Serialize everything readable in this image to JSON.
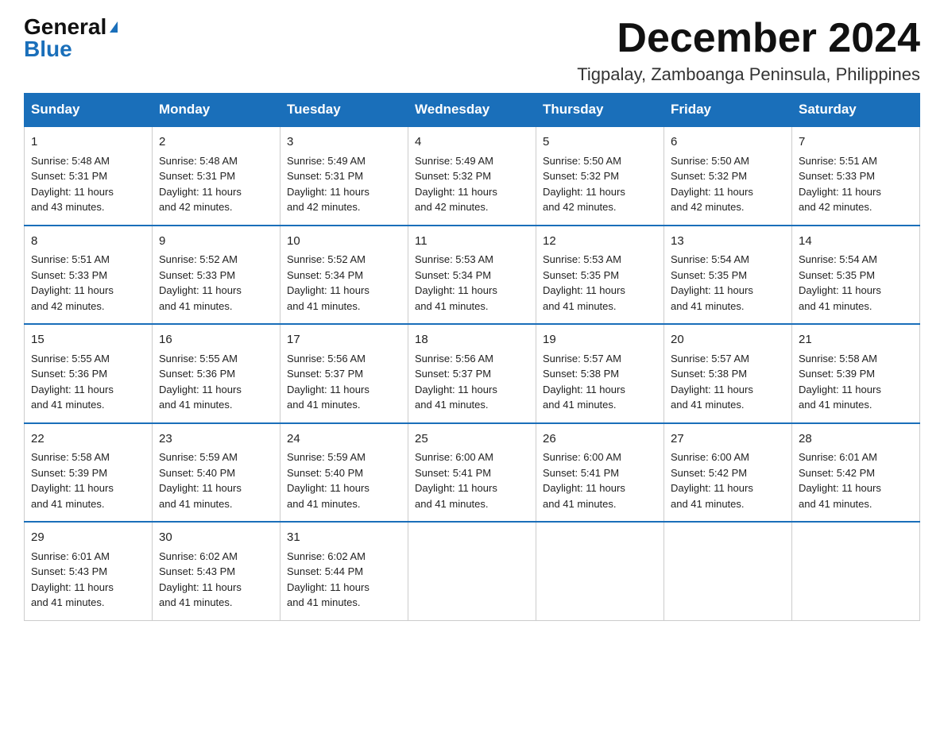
{
  "logo": {
    "general": "General",
    "blue": "Blue"
  },
  "title": {
    "month_year": "December 2024",
    "location": "Tigpalay, Zamboanga Peninsula, Philippines"
  },
  "weekdays": [
    "Sunday",
    "Monday",
    "Tuesday",
    "Wednesday",
    "Thursday",
    "Friday",
    "Saturday"
  ],
  "weeks": [
    [
      {
        "day": "1",
        "sunrise": "5:48 AM",
        "sunset": "5:31 PM",
        "daylight": "11 hours and 43 minutes."
      },
      {
        "day": "2",
        "sunrise": "5:48 AM",
        "sunset": "5:31 PM",
        "daylight": "11 hours and 42 minutes."
      },
      {
        "day": "3",
        "sunrise": "5:49 AM",
        "sunset": "5:31 PM",
        "daylight": "11 hours and 42 minutes."
      },
      {
        "day": "4",
        "sunrise": "5:49 AM",
        "sunset": "5:32 PM",
        "daylight": "11 hours and 42 minutes."
      },
      {
        "day": "5",
        "sunrise": "5:50 AM",
        "sunset": "5:32 PM",
        "daylight": "11 hours and 42 minutes."
      },
      {
        "day": "6",
        "sunrise": "5:50 AM",
        "sunset": "5:32 PM",
        "daylight": "11 hours and 42 minutes."
      },
      {
        "day": "7",
        "sunrise": "5:51 AM",
        "sunset": "5:33 PM",
        "daylight": "11 hours and 42 minutes."
      }
    ],
    [
      {
        "day": "8",
        "sunrise": "5:51 AM",
        "sunset": "5:33 PM",
        "daylight": "11 hours and 42 minutes."
      },
      {
        "day": "9",
        "sunrise": "5:52 AM",
        "sunset": "5:33 PM",
        "daylight": "11 hours and 41 minutes."
      },
      {
        "day": "10",
        "sunrise": "5:52 AM",
        "sunset": "5:34 PM",
        "daylight": "11 hours and 41 minutes."
      },
      {
        "day": "11",
        "sunrise": "5:53 AM",
        "sunset": "5:34 PM",
        "daylight": "11 hours and 41 minutes."
      },
      {
        "day": "12",
        "sunrise": "5:53 AM",
        "sunset": "5:35 PM",
        "daylight": "11 hours and 41 minutes."
      },
      {
        "day": "13",
        "sunrise": "5:54 AM",
        "sunset": "5:35 PM",
        "daylight": "11 hours and 41 minutes."
      },
      {
        "day": "14",
        "sunrise": "5:54 AM",
        "sunset": "5:35 PM",
        "daylight": "11 hours and 41 minutes."
      }
    ],
    [
      {
        "day": "15",
        "sunrise": "5:55 AM",
        "sunset": "5:36 PM",
        "daylight": "11 hours and 41 minutes."
      },
      {
        "day": "16",
        "sunrise": "5:55 AM",
        "sunset": "5:36 PM",
        "daylight": "11 hours and 41 minutes."
      },
      {
        "day": "17",
        "sunrise": "5:56 AM",
        "sunset": "5:37 PM",
        "daylight": "11 hours and 41 minutes."
      },
      {
        "day": "18",
        "sunrise": "5:56 AM",
        "sunset": "5:37 PM",
        "daylight": "11 hours and 41 minutes."
      },
      {
        "day": "19",
        "sunrise": "5:57 AM",
        "sunset": "5:38 PM",
        "daylight": "11 hours and 41 minutes."
      },
      {
        "day": "20",
        "sunrise": "5:57 AM",
        "sunset": "5:38 PM",
        "daylight": "11 hours and 41 minutes."
      },
      {
        "day": "21",
        "sunrise": "5:58 AM",
        "sunset": "5:39 PM",
        "daylight": "11 hours and 41 minutes."
      }
    ],
    [
      {
        "day": "22",
        "sunrise": "5:58 AM",
        "sunset": "5:39 PM",
        "daylight": "11 hours and 41 minutes."
      },
      {
        "day": "23",
        "sunrise": "5:59 AM",
        "sunset": "5:40 PM",
        "daylight": "11 hours and 41 minutes."
      },
      {
        "day": "24",
        "sunrise": "5:59 AM",
        "sunset": "5:40 PM",
        "daylight": "11 hours and 41 minutes."
      },
      {
        "day": "25",
        "sunrise": "6:00 AM",
        "sunset": "5:41 PM",
        "daylight": "11 hours and 41 minutes."
      },
      {
        "day": "26",
        "sunrise": "6:00 AM",
        "sunset": "5:41 PM",
        "daylight": "11 hours and 41 minutes."
      },
      {
        "day": "27",
        "sunrise": "6:00 AM",
        "sunset": "5:42 PM",
        "daylight": "11 hours and 41 minutes."
      },
      {
        "day": "28",
        "sunrise": "6:01 AM",
        "sunset": "5:42 PM",
        "daylight": "11 hours and 41 minutes."
      }
    ],
    [
      {
        "day": "29",
        "sunrise": "6:01 AM",
        "sunset": "5:43 PM",
        "daylight": "11 hours and 41 minutes."
      },
      {
        "day": "30",
        "sunrise": "6:02 AM",
        "sunset": "5:43 PM",
        "daylight": "11 hours and 41 minutes."
      },
      {
        "day": "31",
        "sunrise": "6:02 AM",
        "sunset": "5:44 PM",
        "daylight": "11 hours and 41 minutes."
      },
      null,
      null,
      null,
      null
    ]
  ],
  "labels": {
    "sunrise": "Sunrise:",
    "sunset": "Sunset:",
    "daylight": "Daylight:"
  }
}
